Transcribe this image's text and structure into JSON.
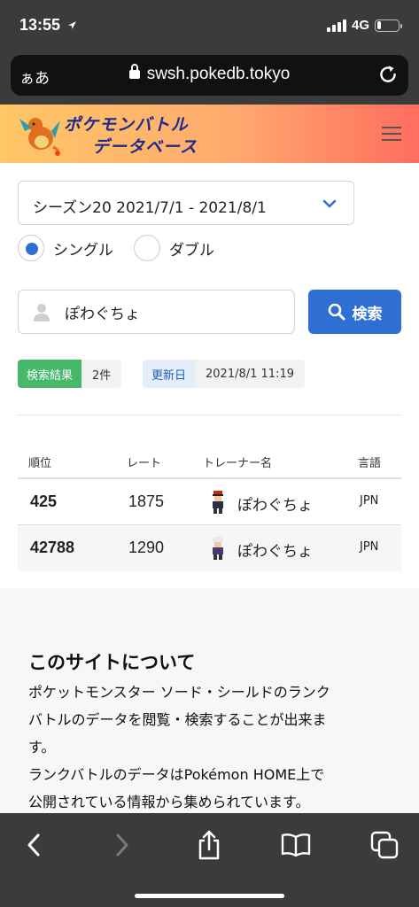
{
  "status_bar": {
    "time": "13:55",
    "network": "4G",
    "battery_level": 0.2
  },
  "browser": {
    "aa_label": "ぁあ",
    "url": "swsh.pokedb.tokyo"
  },
  "site": {
    "logo_line1": "ポケモンバトル",
    "logo_line2": "データベース"
  },
  "form": {
    "season": "シーズン20  2021/7/1 - 2021/8/1",
    "radio_single": "シングル",
    "radio_double": "ダブル",
    "search_value": "ぽわぐちょ",
    "search_button": "検索"
  },
  "tags": {
    "result_key": "検索結果",
    "result_value": "2件",
    "updated_key": "更新日",
    "updated_value": "2021/8/1 11:19"
  },
  "table": {
    "headers": [
      "順位",
      "レート",
      "トレーナー名",
      "言語"
    ],
    "rows": [
      {
        "rank": "425",
        "rate": "1875",
        "name": "ぽわぐちょ",
        "lang": "JPN"
      },
      {
        "rank": "42788",
        "rate": "1290",
        "name": "ぽわぐちょ",
        "lang": "JPN"
      }
    ]
  },
  "about": {
    "title": "このサイトについて",
    "text": "ポケットモンスター ソード・シールドのランクバトルのデータを閲覧・検索することが出来ます。ランクバトルのデータはPokémon HOME上で公開されている情報から集められています。",
    "line1": "ポケットモンスター ソード・シールドのランク",
    "line2": "バトルのデータを閲覧・検索することが出来ま",
    "line3": "す。",
    "line4": "ランクバトルのデータはPokémon HOME上で",
    "line5": "公開されている情報から集められています。"
  },
  "colors": {
    "accent": "#2f6fd3",
    "result_tag": "#45b86a",
    "chrome": "#3b3b3b"
  }
}
